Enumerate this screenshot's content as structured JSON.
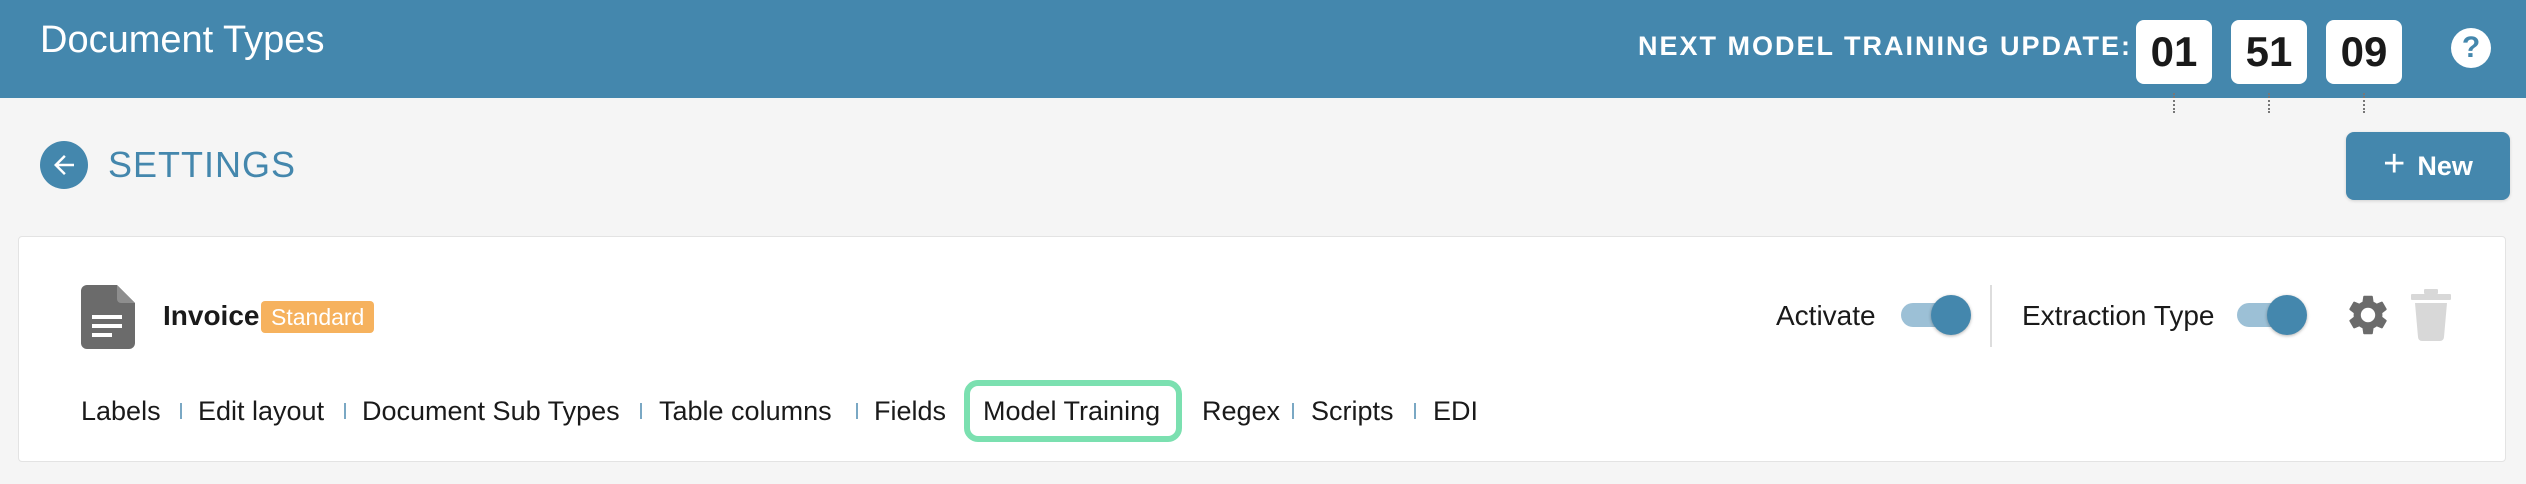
{
  "header": {
    "title": "Document Types",
    "countdown_label": "NEXT MODEL TRAINING UPDATE:",
    "countdown": [
      "01",
      "51",
      "09"
    ],
    "help_icon": "?"
  },
  "page": {
    "back_icon": "arrow-left-icon",
    "title": "SETTINGS",
    "new_button_icon": "+",
    "new_button_label": "New"
  },
  "document_type": {
    "name": "Invoice",
    "badge": "Standard",
    "activate_label": "Activate",
    "activate_on": true,
    "extraction_label": "Extraction Type",
    "extraction_on": true,
    "tabs": [
      "Labels",
      "Edit layout",
      "Document Sub Types",
      "Table columns",
      "Fields",
      "Model Training",
      "Regex",
      "Scripts",
      "EDI"
    ],
    "highlighted_tab": "Model Training"
  },
  "colors": {
    "primary": "#4487ad",
    "badge": "#f6b25e",
    "highlight": "#7be0b0",
    "background": "#f5f5f5"
  }
}
